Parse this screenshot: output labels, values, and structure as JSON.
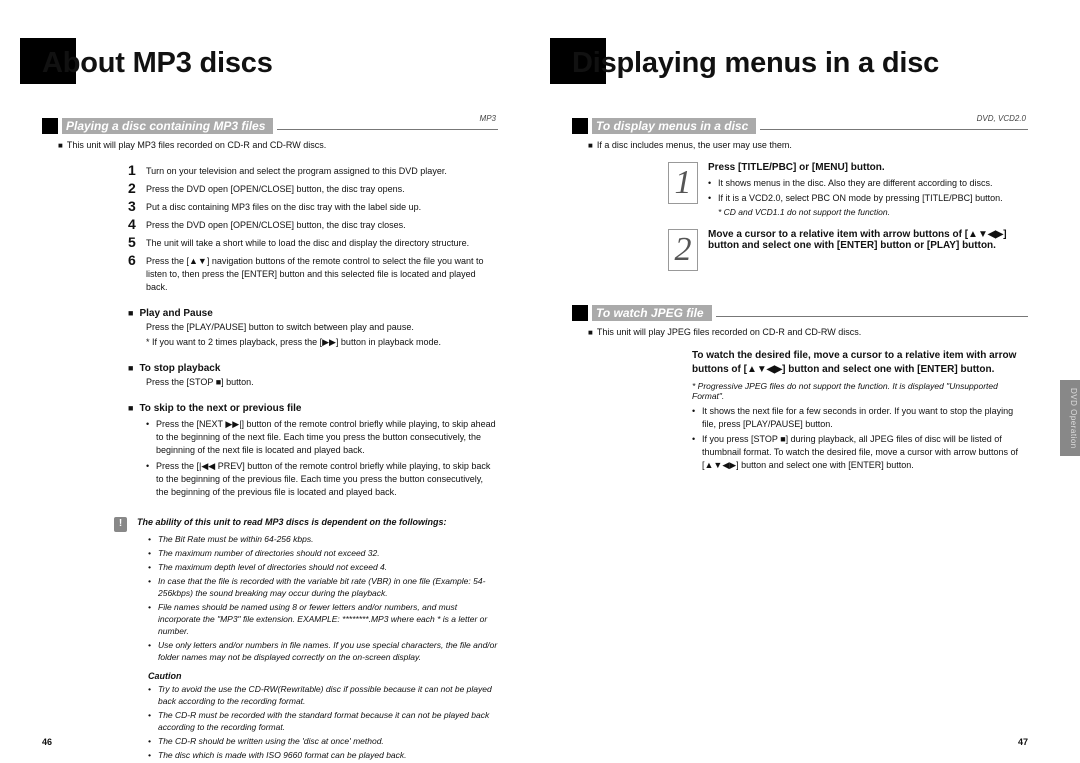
{
  "left": {
    "title": "About MP3 discs",
    "section1": {
      "title": "Playing a disc containing MP3 files",
      "tag": "MP3"
    },
    "intro": "This unit will play MP3 files recorded on CD-R and CD-RW discs.",
    "steps": [
      "Turn on your television and select the program assigned to this DVD player.",
      "Press the DVD open [OPEN/CLOSE] button, the disc tray opens.",
      "Put a disc containing MP3 files on the disc tray with the label side up.",
      "Press the DVD open [OPEN/CLOSE] button, the disc tray closes.",
      "The unit will take a short while to load the disc and display the directory structure.",
      "Press the [▲▼] navigation buttons of the remote control to select the file you want to listen to, then press the [ENTER] button and this selected file is located and played back."
    ],
    "sub_play": {
      "head": "Play and Pause",
      "text": "Press the [PLAY/PAUSE] button to switch between play and pause.",
      "note": "* If you want to 2 times playback, press the [▶▶] button in playback mode."
    },
    "sub_stop": {
      "head": "To stop playback",
      "text": "Press the [STOP ■] button."
    },
    "sub_skip": {
      "head": "To skip to the next or previous file",
      "bullets": [
        "Press the [NEXT ▶▶|] button of the remote control briefly while playing, to skip ahead to the beginning of the next file. Each time you press the button consecutively, the beginning of the next file is located and played back.",
        "Press the [|◀◀ PREV] button of the remote control briefly while playing, to skip back to the beginning of the previous file. Each time you press the button consecutively, the beginning of the previous file is located and played back."
      ]
    },
    "info_lead": "The ability of this unit to read MP3 discs is dependent on the followings:",
    "info_bullets": [
      "The Bit Rate must be within 64-256 kbps.",
      "The maximum number of directories should not exceed 32.",
      "The maximum depth level of directories should not exceed 4.",
      "In case that the file is recorded with the variable bit rate (VBR) in one file (Example: 54-256kbps) the sound breaking may occur during the playback.",
      "File names should be named using 8 or fewer letters and/or numbers, and must incorporate the \"MP3\" file extension. EXAMPLE: ********.MP3 where each * is a letter or number.",
      "Use only letters and/or numbers in file names. If you use special characters, the file and/or folder names may not be displayed correctly on the on-screen display."
    ],
    "caution_label": "Caution",
    "caution_bullets": [
      "Try to avoid the use the CD-RW(Rewritable) disc if possible because it can not be played back according to the recording format.",
      "The CD-R must be recorded with the standard format because it can not be played back according to the recording format.",
      "The CD-R should be written using the 'disc at once' method.",
      "The disc which is made with ISO 9660 format can be played back."
    ],
    "page_num": "46"
  },
  "right": {
    "title": "Displaying menus in a disc",
    "section1": {
      "title": "To display menus in a disc",
      "tag": "DVD, VCD2.0"
    },
    "intro": "If a disc includes menus, the user may use them.",
    "step1": {
      "head": "Press [TITLE/PBC] or [MENU] button.",
      "bullets": [
        "It shows menus in the disc. Also they are different according to discs.",
        "If it is a VCD2.0, select PBC ON mode by pressing [TITLE/PBC] button."
      ],
      "note": "* CD and VCD1.1 do not support the function."
    },
    "step2": {
      "head": "Move a cursor to a relative item with arrow buttons of [▲▼◀▶] button and select one with [ENTER] button or [PLAY] button."
    },
    "section2": {
      "title": "To watch JPEG file"
    },
    "intro2": "This unit will play JPEG files recorded on CD-R and CD-RW discs.",
    "step_jpeg": {
      "head": "To watch the desired file, move a cursor to a relative item with arrow buttons of [▲▼◀▶] button and select one with [ENTER] button.",
      "note": "* Progressive JPEG files do not support the function. It is displayed \"Unsupported Format\".",
      "bullets": [
        "It shows the next file for a few seconds in order. If you want to stop the playing file, press [PLAY/PAUSE] button.",
        "If you press [STOP ■] during playback, all JPEG files of disc will be listed of thumbnail format. To watch the desired file, move a cursor with arrow buttons of [▲▼◀▶] button and select one with [ENTER] button."
      ]
    },
    "side_tab": "DVD Operation",
    "page_num": "47"
  }
}
